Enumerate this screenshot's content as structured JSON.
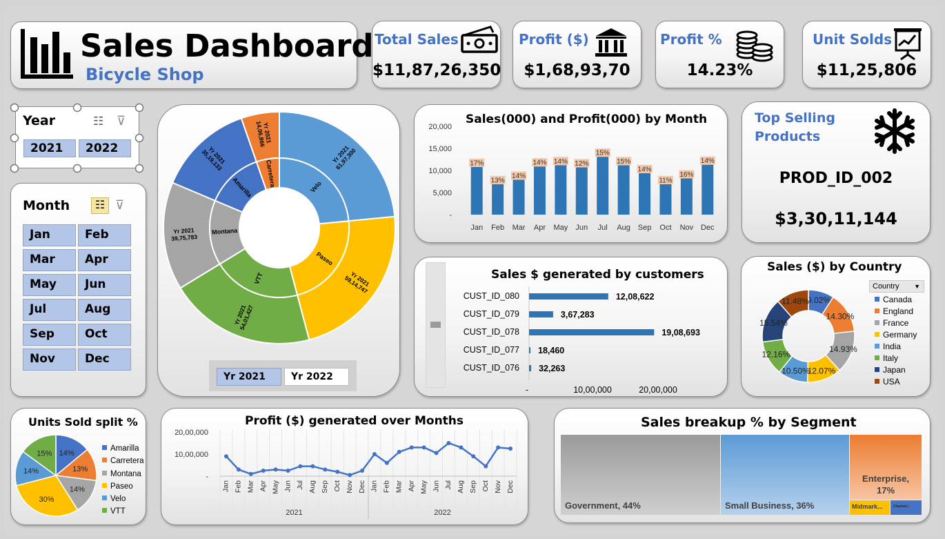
{
  "header": {
    "title": "Sales Dashboard",
    "subtitle": "Bicycle Shop"
  },
  "kpis": [
    {
      "label": "Total Sales",
      "value": "$11,87,26,350",
      "icon": "money-icon"
    },
    {
      "label": "Profit ($)",
      "value": "$1,68,93,70",
      "icon": "bank-icon"
    },
    {
      "label": "Profit %",
      "value": "14.23%",
      "icon": "coins-icon"
    },
    {
      "label": "Unit Solds",
      "value": "$11,25,806",
      "icon": "presentation-icon"
    }
  ],
  "year_slicer": {
    "title": "Year",
    "items": [
      "2021",
      "2022"
    ]
  },
  "month_slicer": {
    "title": "Month",
    "items": [
      "Jan",
      "Feb",
      "Mar",
      "Apr",
      "May",
      "Jun",
      "Jul",
      "Aug",
      "Sep",
      "Oct",
      "Nov",
      "Dec"
    ]
  },
  "top_product": {
    "title": "Top Selling Products",
    "product": "PROD_ID_002",
    "value": "$3,30,11,144",
    "icon": "snowflake-icon"
  },
  "colors": {
    "blue": "#2e75b6",
    "orange": "#ed7d31",
    "gray": "#a5a5a5",
    "gold": "#ffc000",
    "lightblue": "#5b9bd5",
    "green": "#70ad47",
    "navy": "#264478",
    "brown": "#9e480e"
  },
  "chart_data": [
    {
      "id": "sunburst",
      "type": "sunburst",
      "title": "",
      "inner": [
        {
          "name": "Velo",
          "color": "#5b9bd5"
        },
        {
          "name": "Paseo",
          "color": "#ffc000"
        },
        {
          "name": "VTT",
          "color": "#70ad47"
        },
        {
          "name": "Montana",
          "color": "#a5a5a5"
        },
        {
          "name": "Amarilla",
          "color": "#4472c4"
        },
        {
          "name": "Carretera",
          "color": "#ed7d31"
        }
      ],
      "outer": [
        {
          "label": "Yr 2021",
          "value": "61,97,300",
          "parent": "Velo"
        },
        {
          "label": "Yr 2021",
          "value": "59,14,747",
          "parent": "Paseo"
        },
        {
          "label": "Yr 2021",
          "value": "54,01,427",
          "parent": "VTT"
        },
        {
          "label": "Yr 2021",
          "value": "39,75,783",
          "parent": "Montana"
        },
        {
          "label": "Yr 2021",
          "value": "35,19,133",
          "parent": "Amarilla"
        },
        {
          "label": "Yr 2021",
          "value": "14,06,866",
          "parent": "Carretera"
        }
      ],
      "filter_buttons": [
        "Yr 2021",
        "Yr 2022"
      ]
    },
    {
      "id": "monthly",
      "type": "bar",
      "title": "Sales(000) and Profit(000) by Month",
      "categories": [
        "Jan",
        "Feb",
        "Mar",
        "Apr",
        "May",
        "Jun",
        "Jul",
        "Aug",
        "Sep",
        "Oct",
        "Nov",
        "Dec"
      ],
      "values": [
        10800,
        6900,
        7900,
        10900,
        11200,
        10700,
        13100,
        11200,
        9400,
        6900,
        8200,
        11300
      ],
      "labels": [
        "17%",
        "13%",
        "14%",
        "14%",
        "14%",
        "12%",
        "15%",
        "15%",
        "14%",
        "11%",
        "16%",
        "14%"
      ],
      "yticks": [
        "20,000",
        "15,000",
        "10,000",
        "5,000",
        "-"
      ],
      "ylim": [
        0,
        20000
      ]
    },
    {
      "id": "customers",
      "type": "bar",
      "orientation": "horizontal",
      "title": "Sales $ generated  by customers",
      "categories": [
        "CUST_ID_080",
        "CUST_ID_079",
        "CUST_ID_078",
        "CUST_ID_077",
        "CUST_ID_076"
      ],
      "values": [
        1208622,
        367283,
        1908693,
        18460,
        32263
      ],
      "labels": [
        "12,08,622",
        "3,67,283",
        "19,08,693",
        "18,460",
        "32,263"
      ],
      "xticks": [
        "-",
        "10,00,000",
        "20,00,000"
      ],
      "xlim": [
        0,
        2000000
      ]
    },
    {
      "id": "country",
      "type": "pie",
      "title": "Sales ($) by  Country",
      "legend_title": "Country",
      "categories": [
        "Canada",
        "England",
        "France",
        "Germany",
        "India",
        "Italy",
        "Japan",
        "USA"
      ],
      "values": [
        9.02,
        14.3,
        14.93,
        12.07,
        10.5,
        12.16,
        15.54,
        11.48
      ],
      "labels": [
        "9.02%",
        "14.30%",
        "14.93%",
        "12.07%",
        "10.50%",
        "12.16%",
        "15.54%",
        "11.48%"
      ],
      "colors": [
        "#4472c4",
        "#ed7d31",
        "#a5a5a5",
        "#ffc000",
        "#5b9bd5",
        "#70ad47",
        "#264478",
        "#9e480e"
      ]
    },
    {
      "id": "units",
      "type": "pie",
      "title": "Units Sold  split %",
      "categories": [
        "Amarilla",
        "Carretera",
        "Montana",
        "Paseo",
        "Velo",
        "VTT"
      ],
      "values": [
        14,
        13,
        14,
        30,
        14,
        15
      ],
      "labels": [
        "14%",
        "13%",
        "14%",
        "30%",
        "14%",
        "15%"
      ],
      "colors": [
        "#4472c4",
        "#ed7d31",
        "#a5a5a5",
        "#ffc000",
        "#5b9bd5",
        "#70ad47"
      ]
    },
    {
      "id": "profit_line",
      "type": "line",
      "title": "Profit ($) generated over Months",
      "x": [
        "Jan",
        "Feb",
        "Mar",
        "Apr",
        "May",
        "Jun",
        "Jul",
        "Aug",
        "Sep",
        "Oct",
        "Nov",
        "Dec",
        "Jan",
        "Feb",
        "Mar",
        "Apr",
        "May",
        "Jun",
        "Jul",
        "Aug",
        "Sep",
        "Oct",
        "Nov",
        "Dec"
      ],
      "groups": [
        "2021",
        "2022"
      ],
      "values": [
        900000,
        300000,
        100000,
        250000,
        300000,
        250000,
        450000,
        450000,
        300000,
        200000,
        50000,
        250000,
        1000000,
        600000,
        1100000,
        1300000,
        1300000,
        1050000,
        1500000,
        1300000,
        900000,
        450000,
        1300000,
        1250000
      ],
      "yticks": [
        "20,00,000",
        "10,00,000",
        "-"
      ],
      "ylim": [
        0,
        2000000
      ]
    },
    {
      "id": "segment",
      "type": "treemap",
      "title": "Sales breakup % by Segment",
      "items": [
        {
          "label": "Government, 44%",
          "value": 44,
          "color": "#a5a5a5"
        },
        {
          "label": "Small Business, 36%",
          "value": 36,
          "color": "#5b9bd5"
        },
        {
          "label": "Enterprise, 17%",
          "value": 17,
          "color": "#ed7d31"
        },
        {
          "label": "Midmark...",
          "value": 2,
          "color": "#ffc000"
        },
        {
          "label": "Channel...",
          "value": 1,
          "color": "#4472c4"
        }
      ]
    }
  ]
}
